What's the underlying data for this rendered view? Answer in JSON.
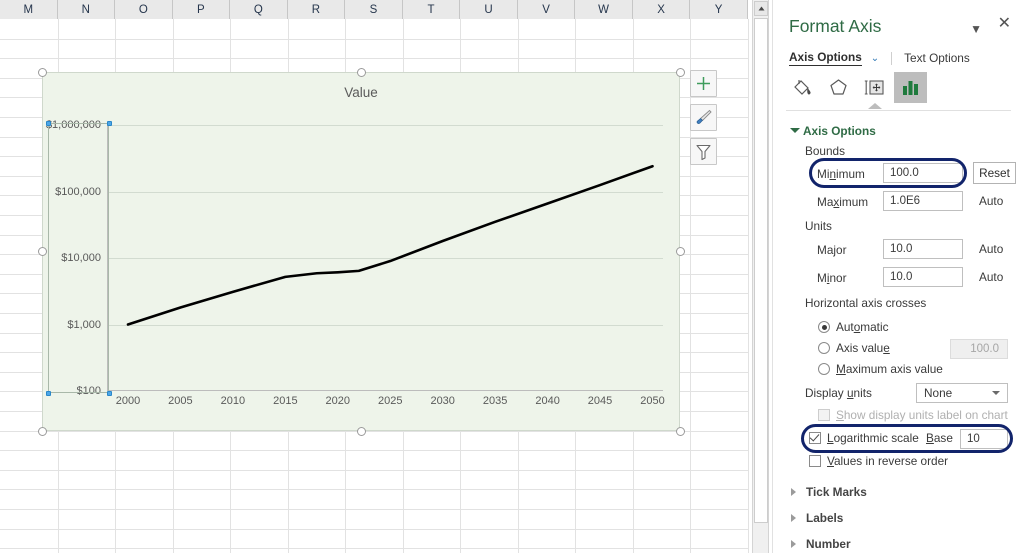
{
  "spreadsheet": {
    "columns": [
      "M",
      "N",
      "O",
      "P",
      "Q",
      "R",
      "S",
      "T",
      "U",
      "V",
      "W",
      "X",
      "Y"
    ]
  },
  "scrollbar": {
    "up_arrow": "▲"
  },
  "chart": {
    "title": "Value",
    "side_buttons": [
      {
        "name": "chart-elements-button",
        "glyph": "+"
      },
      {
        "name": "chart-styles-button",
        "glyph": "brush"
      },
      {
        "name": "chart-filters-button",
        "glyph": "funnel"
      }
    ]
  },
  "chart_data": {
    "type": "line",
    "title": "Value",
    "xlabel": "",
    "ylabel": "",
    "yscale": "log",
    "ylim": [
      100,
      1000000
    ],
    "ytick_labels": [
      "$100",
      "$1,000",
      "$10,000",
      "$100,000",
      "$1,000,000"
    ],
    "ytick_values": [
      100,
      1000,
      10000,
      100000,
      1000000
    ],
    "xlim": [
      1998,
      2051
    ],
    "xtick_labels": [
      "2000",
      "2005",
      "2010",
      "2015",
      "2020",
      "2025",
      "2030",
      "2035",
      "2040",
      "2045",
      "2050"
    ],
    "xtick_values": [
      2000,
      2005,
      2010,
      2015,
      2020,
      2025,
      2030,
      2035,
      2040,
      2045,
      2050
    ],
    "grid": true,
    "legend": false,
    "series": [
      {
        "name": "Value",
        "color": "#000000",
        "x": [
          2000,
          2005,
          2010,
          2015,
          2018,
          2020,
          2022,
          2025,
          2030,
          2035,
          2040,
          2045,
          2050
        ],
        "y": [
          1000,
          1800,
          3100,
          5200,
          5900,
          6100,
          6400,
          9000,
          18000,
          35000,
          66000,
          125000,
          240000
        ]
      }
    ]
  },
  "pane": {
    "title": "Format Axis",
    "collapse_icon": "▼",
    "close_icon": "✕",
    "tabs": {
      "axis_options": "Axis Options",
      "axis_options_chevron": "⌄",
      "text_options": "Text Options"
    },
    "icons": [
      {
        "name": "fill-line-icon",
        "label": "Fill & Line"
      },
      {
        "name": "effects-icon",
        "label": "Effects"
      },
      {
        "name": "size-properties-icon",
        "label": "Size & Properties"
      },
      {
        "name": "axis-options-icon",
        "label": "Axis Options",
        "selected": true
      }
    ],
    "axis_options": {
      "header": "Axis Options",
      "bounds": {
        "group_label": "Bounds",
        "minimum_label": "Minimum",
        "minimum_value": "100.0",
        "minimum_reset": "Reset",
        "maximum_label": "Maximum",
        "maximum_value": "1.0E6",
        "maximum_auto": "Auto"
      },
      "units": {
        "group_label": "Units",
        "major_label": "Major",
        "major_value": "10.0",
        "major_auto": "Auto",
        "minor_label": "Minor",
        "minor_value": "10.0",
        "minor_auto": "Auto"
      },
      "horizontal_axis_crosses": {
        "group_label": "Horizontal axis crosses",
        "automatic_label": "Automatic",
        "axis_value_label": "Axis value",
        "axis_value_input": "100.0",
        "maximum_axis_value_label": "Maximum axis value",
        "selected": "Automatic"
      },
      "display_units": {
        "label": "Display units",
        "value": "None",
        "show_label_checkbox": "Show display units label on chart",
        "show_label_checked": false
      },
      "logarithmic": {
        "label": "Logarithmic scale",
        "checked": true,
        "base_label": "Base",
        "base_value": "10"
      },
      "reverse_order": {
        "label": "Values in reverse order",
        "checked": false
      }
    },
    "collapsed_sections": [
      {
        "label": "Tick Marks"
      },
      {
        "label": "Labels"
      },
      {
        "label": "Number"
      }
    ]
  }
}
